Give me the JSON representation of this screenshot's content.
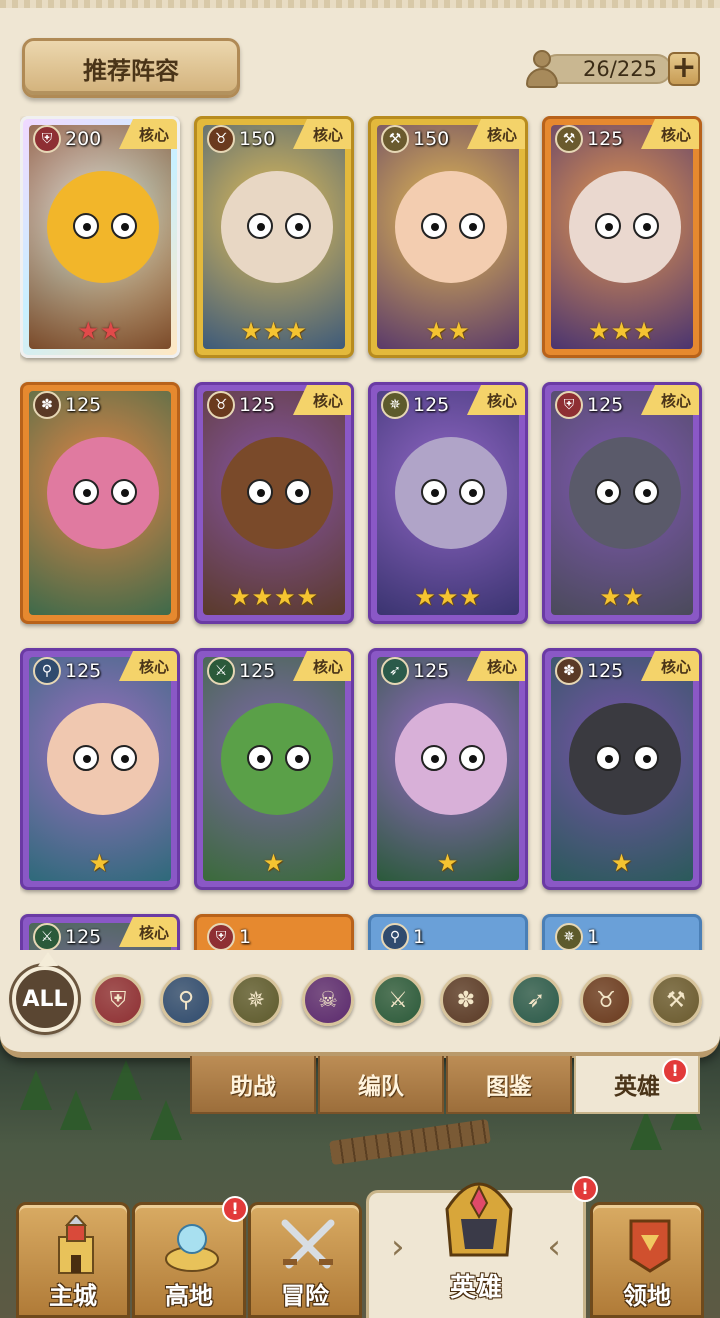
{
  "header": {
    "recommend_label": "推荐阵容",
    "capacity_text": "26/225",
    "add_label": "+"
  },
  "heroes": [
    {
      "power": "200",
      "class_icon": "shield-icon",
      "core": "核心",
      "stars": "★★",
      "star_color": "red",
      "rarity": "rainbow",
      "art_bg": "#7a4a2a",
      "face_color": "#f2b62a"
    },
    {
      "power": "150",
      "class_icon": "ox-icon",
      "core": "核心",
      "stars": "★★★",
      "star_color": "gold",
      "rarity": "gold",
      "art_bg": "#3d5a7a",
      "face_color": "#e8d7c4"
    },
    {
      "power": "150",
      "class_icon": "hammer-icon",
      "core": "核心",
      "stars": "★★",
      "star_color": "gold",
      "rarity": "gold",
      "art_bg": "#5a3a6a",
      "face_color": "#f3cdb0"
    },
    {
      "power": "125",
      "class_icon": "hammer-icon",
      "core": "核心",
      "stars": "★★★",
      "star_color": "gold",
      "rarity": "orange",
      "art_bg": "#4a3470",
      "face_color": "#ead8cf"
    },
    {
      "power": "125",
      "class_icon": "paw-icon",
      "core": "",
      "stars": "",
      "star_color": "gold",
      "rarity": "orange",
      "art_bg": "#3e6a4a",
      "face_color": "#e07aa0"
    },
    {
      "power": "125",
      "class_icon": "ox-icon",
      "core": "核心",
      "stars": "★★★★",
      "star_color": "gold",
      "rarity": "purple",
      "art_bg": "#5a3a2a",
      "face_color": "#7a4a2a"
    },
    {
      "power": "125",
      "class_icon": "wings-icon",
      "core": "核心",
      "stars": "★★★",
      "star_color": "gold",
      "rarity": "purple",
      "art_bg": "#3a3470",
      "face_color": "#b0a4c8"
    },
    {
      "power": "125",
      "class_icon": "shield-icon",
      "core": "核心",
      "stars": "★★",
      "star_color": "gold",
      "rarity": "purple",
      "art_bg": "#4a4a5a",
      "face_color": "#5a5a6a"
    },
    {
      "power": "125",
      "class_icon": "staff-icon",
      "core": "核心",
      "stars": "★",
      "star_color": "gold",
      "rarity": "purple",
      "art_bg": "#2e6a7a",
      "face_color": "#f0c8b0"
    },
    {
      "power": "125",
      "class_icon": "swords-icon",
      "core": "核心",
      "stars": "★",
      "star_color": "gold",
      "rarity": "purple",
      "art_bg": "#3a6a3a",
      "face_color": "#5aa048"
    },
    {
      "power": "125",
      "class_icon": "bow-icon",
      "core": "核心",
      "stars": "★",
      "star_color": "gold",
      "rarity": "purple",
      "art_bg": "#2a5a3a",
      "face_color": "#d8b0d8"
    },
    {
      "power": "125",
      "class_icon": "paw-icon",
      "core": "核心",
      "stars": "★",
      "star_color": "gold",
      "rarity": "purple",
      "art_bg": "#2a5a5a",
      "face_color": "#3a3a40"
    },
    {
      "power": "125",
      "class_icon": "swords-icon",
      "core": "核心",
      "stars": "",
      "star_color": "gold",
      "rarity": "purple",
      "art_bg": "#3a6a3a",
      "face_color": "#5aa048"
    },
    {
      "power": "1",
      "class_icon": "shield-icon",
      "core": "",
      "stars": "",
      "star_color": "gold",
      "rarity": "orange",
      "art_bg": "#3a6a5a",
      "face_color": "#caa"
    },
    {
      "power": "1",
      "class_icon": "staff-icon",
      "core": "",
      "stars": "",
      "star_color": "gold",
      "rarity": "blue",
      "art_bg": "#3a5a7a",
      "face_color": "#caa"
    },
    {
      "power": "1",
      "class_icon": "wings-icon",
      "core": "",
      "stars": "",
      "star_color": "gold",
      "rarity": "blue",
      "art_bg": "#3a5a7a",
      "face_color": "#caa"
    }
  ],
  "filters": [
    {
      "label": "ALL",
      "icon": "all-icon",
      "color": "#5a4632"
    },
    {
      "label": "",
      "icon": "shield-icon",
      "color": "#8e2f33"
    },
    {
      "label": "",
      "icon": "staff-icon",
      "color": "#2f4b6e"
    },
    {
      "label": "",
      "icon": "wings-icon",
      "color": "#5d5a2c"
    },
    {
      "label": "",
      "icon": "skull-icon",
      "color": "#5b2a6e"
    },
    {
      "label": "",
      "icon": "swords-icon",
      "color": "#2b5a3a"
    },
    {
      "label": "",
      "icon": "paw-icon",
      "color": "#5a3a26"
    },
    {
      "label": "",
      "icon": "bow-icon",
      "color": "#2b5a4a"
    },
    {
      "label": "",
      "icon": "ox-icon",
      "color": "#6a3a1e"
    },
    {
      "label": "",
      "icon": "hammer-icon",
      "color": "#6a5a2e"
    }
  ],
  "tabs": [
    {
      "label": "助战"
    },
    {
      "label": "编队"
    },
    {
      "label": "图鉴"
    },
    {
      "label": "英雄"
    }
  ],
  "tab_badge": "!",
  "nav": {
    "castle": "主城",
    "highland": "高地",
    "adventure": "冒险",
    "hero": "英雄",
    "territory": "领地",
    "badge": "!"
  }
}
